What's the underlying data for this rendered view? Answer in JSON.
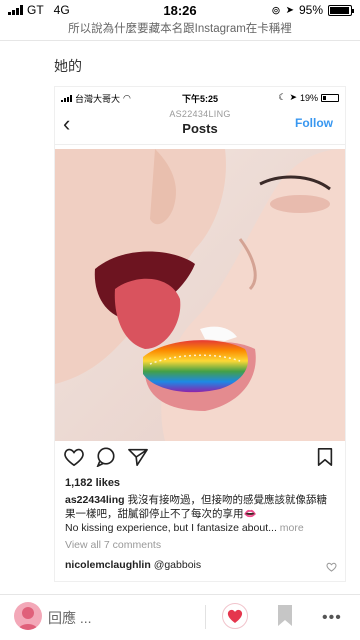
{
  "status_bar": {
    "carrier": "GT",
    "network": "4G",
    "time": "18:26",
    "battery": "95%",
    "battery_level": 0.95
  },
  "header": {
    "title": "所以說為什麼要藏本名跟Instagram在卡稱裡"
  },
  "post": {
    "text": "她的"
  },
  "inner_status": {
    "carrier": "台灣大哥大",
    "time": "下午5:25",
    "battery": "19%",
    "battery_level": 0.19
  },
  "instagram": {
    "username_top": "AS22434LING",
    "title": "Posts",
    "follow_label": "Follow",
    "likes": "1,182 likes",
    "caption_user": "as22434ling",
    "caption_text_zh": "我沒有接吻過，但接吻的感覺應該就像舔糖果一樣吧，甜膩卻停止不了每次的享用👄",
    "caption_text_en": "No kissing experience, but I fantasize about...",
    "caption_more": "more",
    "view_all": "View all 7 comments",
    "comment_user": "nicolemclaughlin",
    "comment_text": "@gabbois"
  },
  "bottom_bar": {
    "reply_placeholder": "回應 ..."
  },
  "colors": {
    "accent_blue": "#3897f0",
    "heart_red": "#e5364d",
    "avatar_pink": "#f3a8b8"
  }
}
